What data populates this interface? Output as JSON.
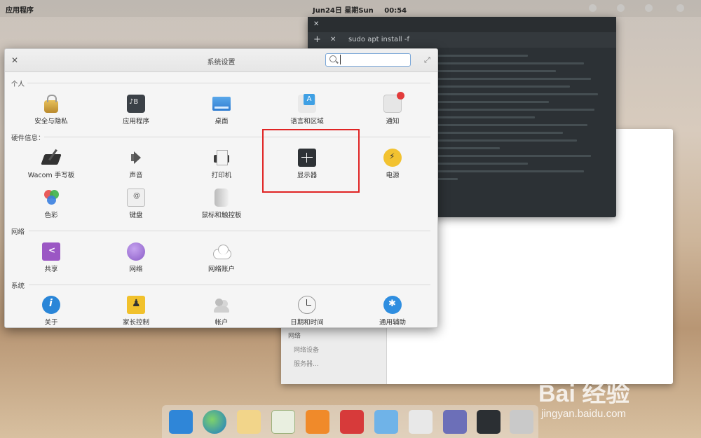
{
  "topbar": {
    "applications": "应用程序",
    "date": "Jun24日 星期Sun",
    "time": "00:54"
  },
  "terminal": {
    "tab_title": "sudo apt install -f"
  },
  "file_window": {
    "section": "网络",
    "items": [
      "网络设备",
      "服务器..."
    ]
  },
  "settings": {
    "title": "系统设置",
    "search": {
      "value": "",
      "placeholder": ""
    },
    "sections": {
      "personal": {
        "title": "个人",
        "items": [
          "安全与隐私",
          "应用程序",
          "桌面",
          "语言和区域",
          "通知"
        ]
      },
      "hardware": {
        "title": "硬件信息：",
        "items": [
          "Wacom 手写板",
          "声音",
          "打印机",
          "显示器",
          "电源",
          "色彩",
          "键盘",
          "鼠标和触控板"
        ]
      },
      "network": {
        "title": "网络",
        "items": [
          "共享",
          "网络",
          "网络账户"
        ]
      },
      "system": {
        "title": "系统",
        "items": [
          "关于",
          "家长控制",
          "帐户",
          "日期和时间",
          "通用辅助"
        ]
      }
    }
  },
  "dock": {
    "icons": [
      "multitasking-view-icon",
      "web-browser-icon",
      "mail-icon",
      "calendar-icon",
      "music-icon",
      "videos-icon",
      "photos-icon",
      "system-settings-icon",
      "app-center-icon",
      "terminal-icon",
      "files-icon"
    ]
  },
  "watermark": {
    "brand": "Bai 经验",
    "url": "jingyan.baidu.com"
  },
  "colors": {
    "highlight": "#e02424",
    "accent": "#2a86d8"
  }
}
